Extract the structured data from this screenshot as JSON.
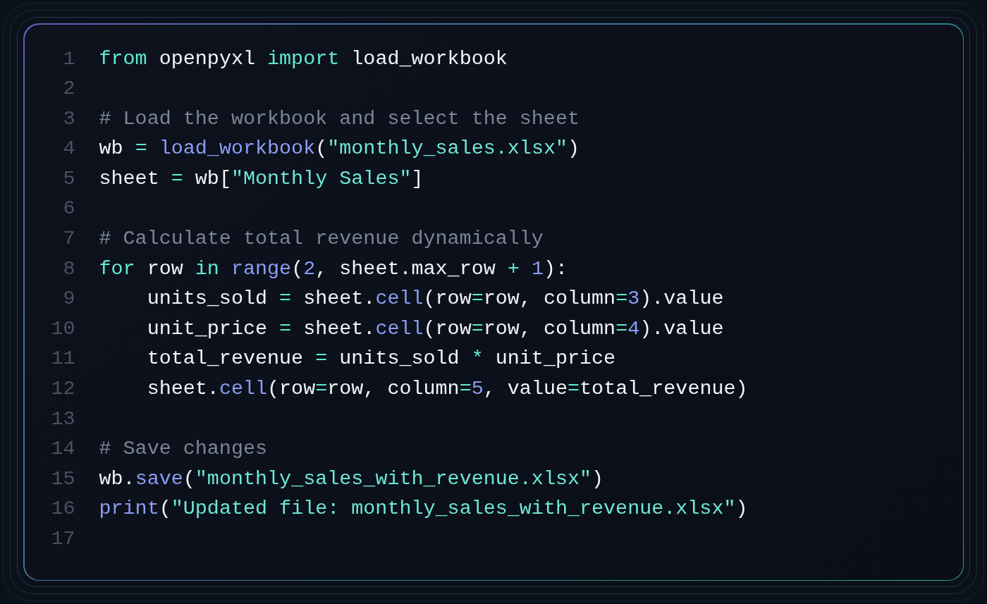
{
  "code_lines": [
    {
      "number": "1",
      "tokens": [
        {
          "kind": "keyword",
          "text": "from"
        },
        {
          "kind": "plain",
          "text": " openpyxl "
        },
        {
          "kind": "keyword",
          "text": "import"
        },
        {
          "kind": "plain",
          "text": " load_workbook"
        }
      ]
    },
    {
      "number": "2"
    },
    {
      "number": "3",
      "tokens": [
        {
          "kind": "comment",
          "text": "# Load the workbook and select the sheet"
        }
      ]
    },
    {
      "number": "4",
      "tokens": [
        {
          "kind": "plain",
          "text": "wb "
        },
        {
          "kind": "operator",
          "text": "="
        },
        {
          "kind": "function",
          "text": " load_workbook"
        },
        {
          "kind": "plain",
          "text": "("
        },
        {
          "kind": "string",
          "text": "\"monthly_sales.xlsx\""
        },
        {
          "kind": "plain",
          "text": ")"
        }
      ]
    },
    {
      "number": "5",
      "tokens": [
        {
          "kind": "plain",
          "text": "sheet "
        },
        {
          "kind": "operator",
          "text": "="
        },
        {
          "kind": "plain",
          "text": " wb["
        },
        {
          "kind": "string",
          "text": "\"Monthly Sales\""
        },
        {
          "kind": "plain",
          "text": "]"
        }
      ]
    },
    {
      "number": "6"
    },
    {
      "number": "7",
      "tokens": [
        {
          "kind": "comment",
          "text": "# Calculate total revenue dynamically"
        }
      ]
    },
    {
      "number": "8",
      "tokens": [
        {
          "kind": "keyword",
          "text": "for"
        },
        {
          "kind": "plain",
          "text": " row "
        },
        {
          "kind": "keyword",
          "text": "in"
        },
        {
          "kind": "function",
          "text": " range"
        },
        {
          "kind": "plain",
          "text": "("
        },
        {
          "kind": "number",
          "text": "2"
        },
        {
          "kind": "plain",
          "text": ", sheet.max_row "
        },
        {
          "kind": "operator",
          "text": "+"
        },
        {
          "kind": "number",
          "text": " 1"
        },
        {
          "kind": "plain",
          "text": "):"
        }
      ]
    },
    {
      "number": "9",
      "tokens": [
        {
          "kind": "plain",
          "text": "    units_sold "
        },
        {
          "kind": "operator",
          "text": "="
        },
        {
          "kind": "plain",
          "text": " sheet."
        },
        {
          "kind": "function",
          "text": "cell"
        },
        {
          "kind": "plain",
          "text": "(row"
        },
        {
          "kind": "operator",
          "text": "="
        },
        {
          "kind": "plain",
          "text": "row, column"
        },
        {
          "kind": "operator",
          "text": "="
        },
        {
          "kind": "number",
          "text": "3"
        },
        {
          "kind": "plain",
          "text": ").value"
        }
      ]
    },
    {
      "number": "10",
      "tokens": [
        {
          "kind": "plain",
          "text": "    unit_price "
        },
        {
          "kind": "operator",
          "text": "="
        },
        {
          "kind": "plain",
          "text": " sheet."
        },
        {
          "kind": "function",
          "text": "cell"
        },
        {
          "kind": "plain",
          "text": "(row"
        },
        {
          "kind": "operator",
          "text": "="
        },
        {
          "kind": "plain",
          "text": "row, column"
        },
        {
          "kind": "operator",
          "text": "="
        },
        {
          "kind": "number",
          "text": "4"
        },
        {
          "kind": "plain",
          "text": ").value"
        }
      ]
    },
    {
      "number": "11",
      "tokens": [
        {
          "kind": "plain",
          "text": "    total_revenue "
        },
        {
          "kind": "operator",
          "text": "="
        },
        {
          "kind": "plain",
          "text": " units_sold "
        },
        {
          "kind": "operator",
          "text": "*"
        },
        {
          "kind": "plain",
          "text": " unit_price"
        }
      ]
    },
    {
      "number": "12",
      "tokens": [
        {
          "kind": "plain",
          "text": "    sheet."
        },
        {
          "kind": "function",
          "text": "cell"
        },
        {
          "kind": "plain",
          "text": "(row"
        },
        {
          "kind": "operator",
          "text": "="
        },
        {
          "kind": "plain",
          "text": "row, column"
        },
        {
          "kind": "operator",
          "text": "="
        },
        {
          "kind": "number",
          "text": "5"
        },
        {
          "kind": "plain",
          "text": ", value"
        },
        {
          "kind": "operator",
          "text": "="
        },
        {
          "kind": "plain",
          "text": "total_revenue)"
        }
      ]
    },
    {
      "number": "13"
    },
    {
      "number": "14",
      "tokens": [
        {
          "kind": "comment",
          "text": "# Save changes"
        }
      ]
    },
    {
      "number": "15",
      "tokens": [
        {
          "kind": "plain",
          "text": "wb."
        },
        {
          "kind": "function",
          "text": "save"
        },
        {
          "kind": "plain",
          "text": "("
        },
        {
          "kind": "string",
          "text": "\"monthly_sales_with_revenue.xlsx\""
        },
        {
          "kind": "plain",
          "text": ")"
        }
      ]
    },
    {
      "number": "16",
      "tokens": [
        {
          "kind": "function",
          "text": "print"
        },
        {
          "kind": "plain",
          "text": "("
        },
        {
          "kind": "string",
          "text": "\"Updated file: monthly_sales_with_revenue.xlsx\""
        },
        {
          "kind": "plain",
          "text": ")"
        }
      ]
    },
    {
      "number": "17"
    }
  ]
}
